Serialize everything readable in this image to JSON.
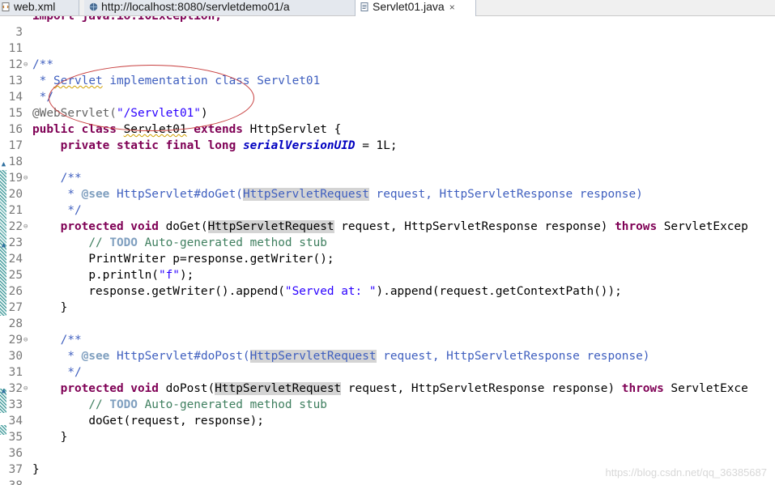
{
  "tabs": [
    {
      "label": "web.xml",
      "icon": "xml-file-icon"
    },
    {
      "label": "http://localhost:8080/servletdemo01/a",
      "icon": "globe-icon"
    },
    {
      "label": "Servlet01.java",
      "icon": "java-file-icon",
      "active": true,
      "close": "×"
    }
  ],
  "code": {
    "top_partial": "import java.io.IOException;",
    "lines": [
      {
        "n": "11"
      },
      {
        "n": "12"
      },
      {
        "n": "13",
        "fold": "⊖",
        "comment_open": "/**"
      },
      {
        "n": "14",
        "c1": " * ",
        "c2": "Servlet",
        "c3": " implementation class Servlet01"
      },
      {
        "n": "15",
        "text": " */"
      },
      {
        "n": "16",
        "annotation": "@WebServlet(",
        "str": "\"/Servlet01\"",
        "close": ")"
      },
      {
        "n": "17",
        "kw1": "public class",
        "name": "Servlet01",
        "kw2": "extends",
        "rest": "HttpServlet {"
      },
      {
        "n": "18",
        "kw": "private static final long",
        "field": "serialVersionUID",
        "rest": " = 1L;"
      },
      {
        "n": "19"
      },
      {
        "n": "20",
        "fold": "⊖",
        "text": "/**"
      },
      {
        "n": "21",
        "pre": " * ",
        "tag": "@see",
        "a": " HttpServlet#doGet(",
        "hl": "HttpServletRequest",
        "b": " request, HttpServletResponse response)"
      },
      {
        "n": "22",
        "text": " */"
      },
      {
        "n": "23",
        "fold": "⊖",
        "kw1": "protected void",
        "a": " doGet(",
        "hl": "HttpServletRequest",
        "b": " request, HttpServletResponse response) ",
        "kw2": "throws",
        "c": " ServletExcep"
      },
      {
        "n": "24",
        "lc1": "// ",
        "todo": "TODO",
        "lc2": " Auto-generated method stub"
      },
      {
        "n": "25",
        "text": "PrintWriter p=response.getWriter();"
      },
      {
        "n": "26",
        "a": "p.println(",
        "str": "\"f\"",
        "b": ");"
      },
      {
        "n": "27",
        "a": "response.getWriter().append(",
        "str": "\"Served at: \"",
        "b": ").append(request.getContextPath());"
      },
      {
        "n": "28",
        "text": "}"
      },
      {
        "n": "29"
      },
      {
        "n": "30",
        "fold": "⊖",
        "text": "/**"
      },
      {
        "n": "31",
        "pre": " * ",
        "tag": "@see",
        "a": " HttpServlet#doPost(",
        "hl": "HttpServletRequest",
        "b": " request, HttpServletResponse response)"
      },
      {
        "n": "32",
        "text": " */"
      },
      {
        "n": "33",
        "fold": "⊖",
        "kw1": "protected void",
        "a": " doPost(",
        "hl": "HttpServletRequest",
        "b": " request, HttpServletResponse response) ",
        "kw2": "throws",
        "c": " ServletExce"
      },
      {
        "n": "34",
        "lc1": "// ",
        "todo": "TODO",
        "lc2": " Auto-generated method stub"
      },
      {
        "n": "35",
        "text": "doGet(request, response);"
      },
      {
        "n": "36",
        "text": "}"
      },
      {
        "n": "37"
      },
      {
        "n": "38",
        "text": "}"
      }
    ]
  },
  "watermark": "https://blog.csdn.net/qq_36385687",
  "colors": {
    "keyword": "#7f0055",
    "javadoc": "#3f5fbf",
    "string": "#2a00ff",
    "line_comment": "#3f7f5f",
    "annotation_circle": "#c84040"
  }
}
